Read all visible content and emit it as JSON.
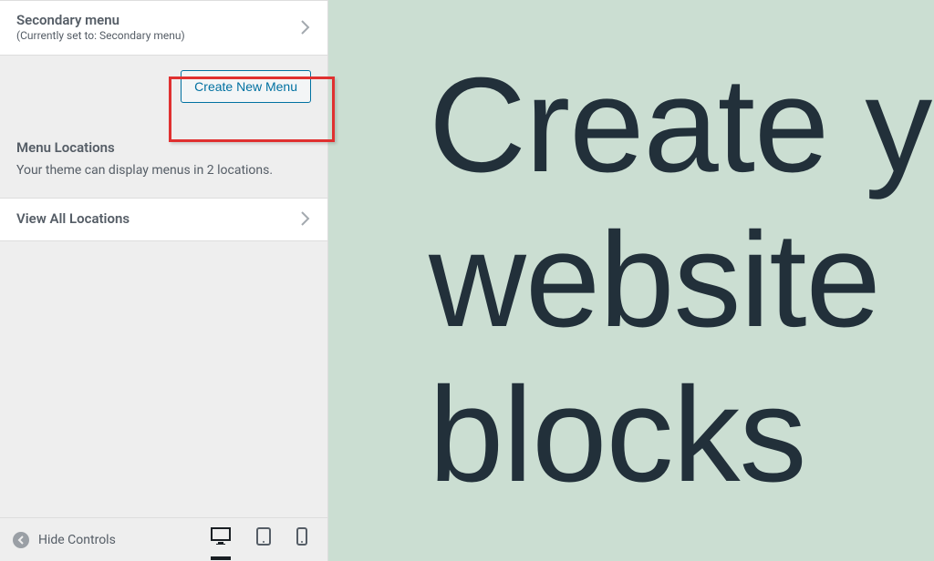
{
  "sidebar": {
    "secondary_menu": {
      "title": "Secondary menu",
      "subtitle": "(Currently set to: Secondary menu)"
    },
    "create_new_menu_label": "Create New Menu",
    "menu_locations": {
      "heading": "Menu Locations",
      "description": "Your theme can display menus in 2 locations."
    },
    "view_all_locations_label": "View All Locations"
  },
  "footer": {
    "hide_controls_label": "Hide Controls"
  },
  "preview": {
    "hero_line1": "Create y",
    "hero_line2": "website",
    "hero_line3": "blocks"
  }
}
